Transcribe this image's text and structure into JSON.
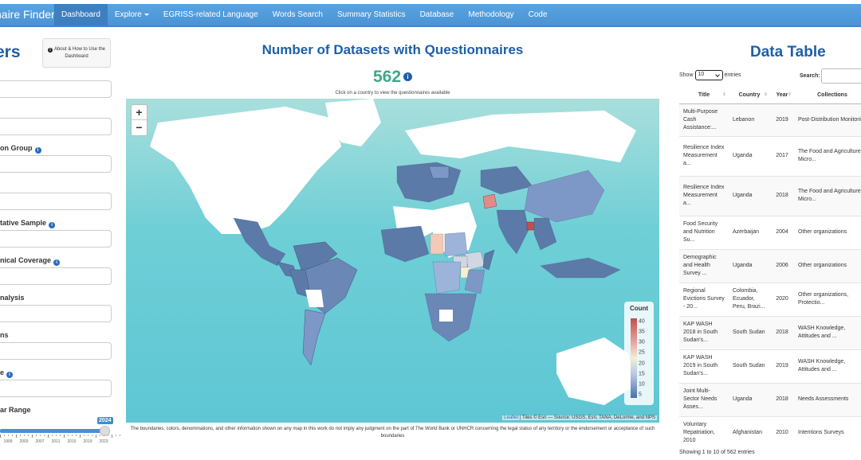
{
  "navbar": {
    "brand": "naire Finder",
    "items": [
      {
        "label": "Dashboard",
        "active": true
      },
      {
        "label": "Explore",
        "dropdown": true
      },
      {
        "label": "EGRISS-related Language"
      },
      {
        "label": "Words Search"
      },
      {
        "label": "Summary Statistics"
      },
      {
        "label": "Database"
      },
      {
        "label": "Methodology"
      },
      {
        "label": "Code"
      }
    ]
  },
  "filters": {
    "title": "ers",
    "about_button": "About & How to Use the Dashboard",
    "fields": [
      {
        "label": "",
        "value": ""
      },
      {
        "label": "",
        "value": ""
      },
      {
        "label": "on Group",
        "info": true,
        "value": ""
      },
      {
        "label": "",
        "value": ""
      },
      {
        "label": "tative Sample",
        "info": true,
        "value": ""
      },
      {
        "label": "nical Coverage",
        "info": true,
        "value": ""
      },
      {
        "label": "nalysis",
        "value": ""
      },
      {
        "label": "ns",
        "value": ""
      },
      {
        "label": "e",
        "info": true,
        "value": ""
      }
    ],
    "year_range": {
      "label": "ar Range",
      "value": "2024",
      "tick_labels": [
        "1999",
        "2003",
        "2007",
        "2011",
        "2015",
        "2019",
        "2023"
      ]
    }
  },
  "map_panel": {
    "title": "Number of Datasets with Questionnaires",
    "count": "562",
    "hint": "Click on a country to view the questionnaires available",
    "zoom_in": "+",
    "zoom_out": "−",
    "legend": {
      "title": "Count",
      "labels": [
        "40",
        "35",
        "30",
        "25",
        "20",
        "15",
        "10",
        "5"
      ],
      "colors": {
        "high": "#c0504d",
        "mid": "#f3efd2",
        "low": "#4a71ad"
      }
    },
    "attribution_link": "Leaflet",
    "attribution_text": " | Tiles © Esri — Source: USGS, Esri, TANA, DeLorme, and NPS",
    "disclaimer": "The boundaries, colors, denominations, and other information shown on any map in this work do not imply any judgment on the part of The World Bank or UNHCR concerning the legal status of any territory or the endorsement or acceptance of such boundaries"
  },
  "data_table": {
    "title": "Data Table",
    "show_label": "Show",
    "entries_value": "10",
    "entries_label": "entries",
    "search_label": "Search:",
    "search_value": "",
    "columns": [
      "Title",
      "Country",
      "Year",
      "Collections"
    ],
    "rows": [
      {
        "title": "Multi-Purpose Cash Assistance:...",
        "country": "Lebanon",
        "year": "2019",
        "collections": "Post-Distribution Monitoring"
      },
      {
        "title": "Resilience Index Measurement a...",
        "country": "Uganda",
        "year": "2017",
        "collections": "The Food and Agriculture Micro..."
      },
      {
        "title": "Resilience Index Measurement a...",
        "country": "Uganda",
        "year": "2018",
        "collections": "The Food and Agriculture Micro..."
      },
      {
        "title": "Food Security and Nutrition Su...",
        "country": "Azerbaijan",
        "year": "2004",
        "collections": "Other organizations"
      },
      {
        "title": "Demographic and Health Survey ...",
        "country": "Uganda",
        "year": "2006",
        "collections": "Other organizations"
      },
      {
        "title": "Regional Evictions Survey - 20...",
        "country": "Colombia, Ecuador, Peru, Brazi...",
        "year": "2020",
        "collections": "Other organizations, Protectio..."
      },
      {
        "title": "KAP WASH 2018 in South Sudan's...",
        "country": "South Sudan",
        "year": "2018",
        "collections": "WASH Knowledge, Attitudes and ..."
      },
      {
        "title": "KAP WASH 2019 in South Sudan's...",
        "country": "South Sudan",
        "year": "2019",
        "collections": "WASH Knowledge, Attitudes and ..."
      },
      {
        "title": "Joint Multi-Sector Needs Asses...",
        "country": "Uganda",
        "year": "2018",
        "collections": "Needs Assessments"
      },
      {
        "title": "Voluntary Repatriation, 2010",
        "country": "Afghanistan",
        "year": "2010",
        "collections": "Intentions Surveys"
      }
    ],
    "info": "Showing 1 to 10 of 562 entries"
  }
}
